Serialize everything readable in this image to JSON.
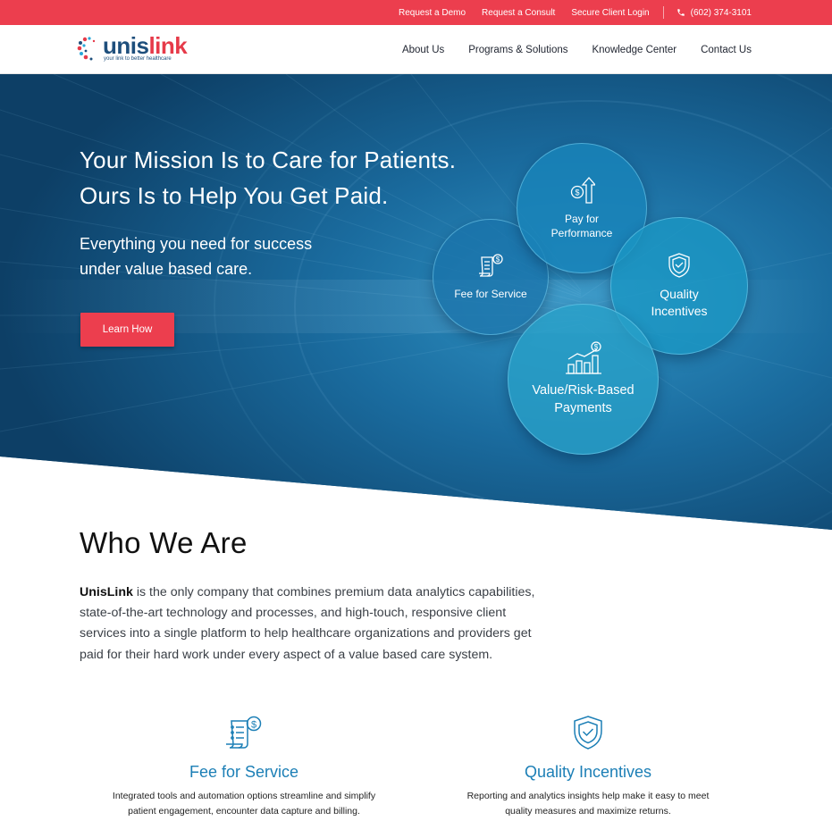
{
  "topbar": {
    "links": [
      "Request a Demo",
      "Request a Consult",
      "Secure Client Login"
    ],
    "phone": "(602) 374-3101",
    "background": "#ec3e4e"
  },
  "header": {
    "logo_text_part1": "unis",
    "logo_text_part2": "link",
    "logo_tagline": "your link to better healthcare",
    "nav": [
      "About Us",
      "Programs & Solutions",
      "Knowledge Center",
      "Contact Us"
    ]
  },
  "hero": {
    "headline_line1": "Your Mission Is to Care for Patients.",
    "headline_line2": "Ours Is to Help You Get Paid.",
    "sub_line1": "Everything you need for success",
    "sub_line2": "under value based care.",
    "cta_label": "Learn How",
    "bubbles": {
      "fee": {
        "label": "Fee for Service",
        "icon": "invoice-dollar-icon"
      },
      "pay": {
        "line1": "Pay for",
        "line2": "Performance",
        "icon": "dollar-arrow-up-icon"
      },
      "quality": {
        "line1": "Quality",
        "line2": "Incentives",
        "icon": "shield-check-icon"
      },
      "value": {
        "line1": "Value/Risk-Based",
        "line2": "Payments",
        "icon": "bar-chart-dollar-icon"
      }
    }
  },
  "who": {
    "title": "Who We Are",
    "brand": "UnisLink",
    "body": " is the only company that combines premium data analytics capabilities, state-of-the-art technology and processes, and high-touch, responsive client services into a single platform to help healthcare organizations and providers get paid for their hard work under every aspect of a value based care system."
  },
  "features": [
    {
      "title": "Fee for Service",
      "line1": "Integrated tools and automation options streamline and simplify",
      "line2": "patient engagement, encounter data capture and billing.",
      "icon": "invoice-dollar-icon"
    },
    {
      "title": "Quality Incentives",
      "line1": "Reporting and analytics insights help make it easy to meet",
      "line2": "quality measures and maximize returns.",
      "icon": "shield-check-icon"
    }
  ],
  "colors": {
    "accent_red": "#ec3e4e",
    "hero_blue": "#0f4f7c",
    "feature_blue": "#1c7fb6"
  }
}
